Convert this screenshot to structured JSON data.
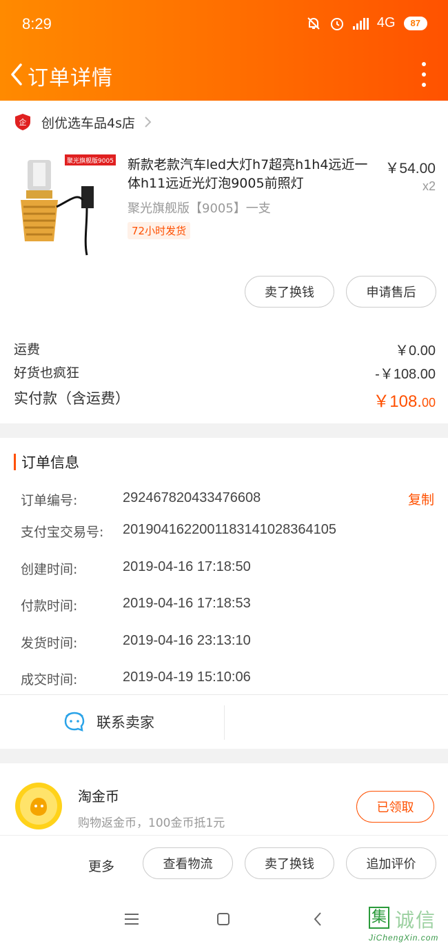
{
  "status_bar": {
    "time": "8:29",
    "network": "4G",
    "battery": "87"
  },
  "nav": {
    "title": "订单详情"
  },
  "shop": {
    "name": "创优选车品4s店"
  },
  "product": {
    "image_badge": "聚光旗舰版9005",
    "title": "新款老款汽车led大灯h7超亮h1h4远近一体h11远近光灯泡9005前照灯",
    "price": "￥54.00",
    "quantity": "x2",
    "sku": "聚光旗舰版【9005】一支",
    "tag": "72小时发货"
  },
  "product_actions": {
    "trade_in": "卖了换钱",
    "after_sale": "申请售后"
  },
  "fees": {
    "shipping_label": "运费",
    "shipping_value": "￥0.00",
    "discount_label": "好货也疯狂",
    "discount_value": "-￥108.00",
    "total_label": "实付款（含运费）",
    "total_main": "￥108.",
    "total_cents": "00"
  },
  "order_info": {
    "section_title": "订单信息",
    "copy_label": "复制",
    "rows": [
      {
        "label": "订单编号:",
        "value": "292467820433476608"
      },
      {
        "label": "支付宝交易号:",
        "value": "2019041622001183141028364105"
      },
      {
        "label": "创建时间:",
        "value": "2019-04-16 17:18:50"
      },
      {
        "label": "付款时间:",
        "value": "2019-04-16 17:18:53"
      },
      {
        "label": "发货时间:",
        "value": "2019-04-16 23:13:10"
      },
      {
        "label": "成交时间:",
        "value": "2019-04-19 15:10:06"
      }
    ],
    "contact_label": "联系卖家"
  },
  "coins": {
    "title": "淘金币",
    "subtitle": "购物返金币，100金币抵1元",
    "button": "已领取"
  },
  "bottom_actions": {
    "more": "更多",
    "logistics": "查看物流",
    "trade_in": "卖了换钱",
    "add_review": "追加评价"
  },
  "watermark": {
    "icon_char": "集",
    "text": "诚信",
    "url": "JiChengXin.com"
  },
  "colors": {
    "accent": "#ff5000",
    "header_start": "#ff8a00",
    "header_end": "#ff5200"
  }
}
